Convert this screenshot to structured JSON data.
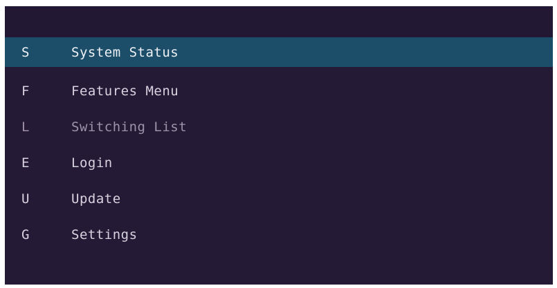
{
  "menu": {
    "items": [
      {
        "key": "S",
        "label": "System Status",
        "selected": true
      },
      {
        "key": "F",
        "label": "Features Menu",
        "selected": false
      },
      {
        "key": "L",
        "label": "Switching List",
        "selected": false,
        "dimmed": true
      },
      {
        "key": "E",
        "label": "Login",
        "selected": false
      },
      {
        "key": "U",
        "label": "Update",
        "selected": false
      },
      {
        "key": "G",
        "label": "Settings",
        "selected": false
      }
    ]
  },
  "colors": {
    "background": "#251a35",
    "selection": "#1c4d69",
    "text": "#d8d3e0"
  }
}
